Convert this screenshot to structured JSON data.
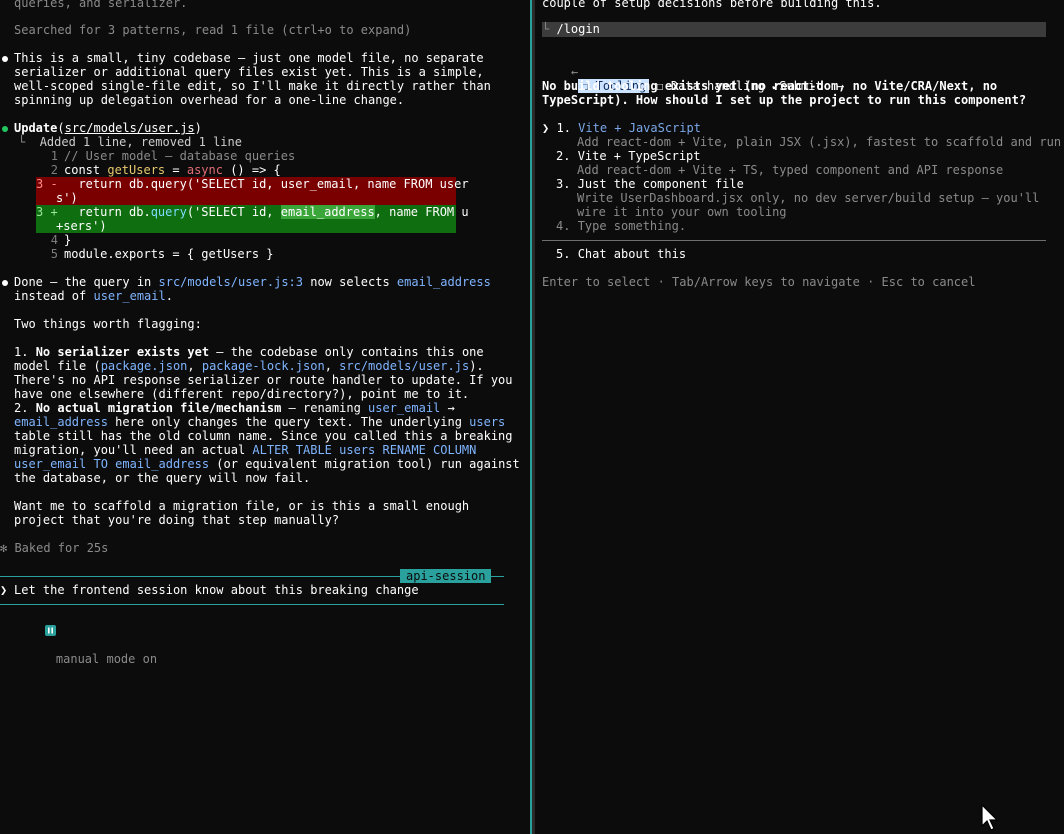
{
  "left": {
    "top_clip": "queries, and serializer.",
    "searched": "Searched for 3 patterns, read 1 file (ctrl+o to expand)",
    "para1": [
      "This is a small, tiny codebase — just one model file, no separate",
      "serializer or additional query files exist yet. This is a simple,",
      "well-scoped single-file edit, so I'll make it directly rather than",
      "spinning up delegation overhead for a one-line change."
    ],
    "update_label": "Update",
    "update_path": "src/models/user.js",
    "added_removed": "Added 1 line, removed 1 line",
    "diff": {
      "l1_num": "1",
      "l1": "// User model — database queries",
      "l2_num": "2",
      "l2_a": "const ",
      "l2_b": "getUsers",
      "l2_c": " = ",
      "l2_d": "async",
      "l2_e": " () => {",
      "l3_num": "3 -",
      "l3": "  return db.query('SELECT id, user_email, name FROM user",
      "l3_wrap": "s')",
      "l3add_num": "3 +",
      "l3add_a": "  return db.",
      "l3add_b": "query",
      "l3add_c": "('SELECT id, ",
      "l3add_d": "email_address",
      "l3add_e": ", name FROM u",
      "l3add_wrap": "+sers')",
      "l4_num": "4",
      "l4": "}",
      "l5_num": "5",
      "l5": "module.exports = { getUsers }"
    },
    "done_a": "Done — the query in ",
    "done_b": "src/models/user.js:3",
    "done_c": " now selects ",
    "done_d": "email_address",
    "done_e": "instead of ",
    "done_f": "user_email",
    "done_g": ".",
    "flag": "Two things worth flagging:",
    "item1_num": "1. ",
    "item1_bold": "No serializer exists yet",
    "item1_a": " — the codebase only contains this one",
    "item1_b1": "model file (",
    "item1_b2": "package.json",
    "item1_b3": ", ",
    "item1_b4": "package-lock.json",
    "item1_b5": ", ",
    "item1_b6": "src/models/user.js",
    "item1_b7": ").",
    "item1_c": "There's no API response serializer or route handler to update. If you",
    "item1_d": "have one elsewhere (different repo/directory?), point me to it.",
    "item2_num": "2. ",
    "item2_bold": "No actual migration file/mechanism",
    "item2_a1": " — renaming ",
    "item2_a2": "user_email",
    "item2_a3": " →",
    "item2_b1": "email_address",
    "item2_b2": " here only changes the query text. The underlying ",
    "item2_b3": "users",
    "item2_c": "table still has the old column name. Since you called this a breaking",
    "item2_d1": "migration, you'll need an actual ",
    "item2_d2": "ALTER TABLE users RENAME COLUMN",
    "item2_e1": "user_email TO email_address",
    "item2_e2": " (or equivalent migration tool) run against",
    "item2_f": "the database, or the query will now fail.",
    "want1": "Want me to scaffold a migration file, or is this a small enough",
    "want2": "project that you're doing that step manually?",
    "baked": "✻ Baked for 25s",
    "session_tag": "api-session",
    "prompt_char": "❯",
    "prompt_text": "Let the frontend session know about this breaking change",
    "mode_text": "manual mode on"
  },
  "right": {
    "top_clip": "couple of setup decisions before building this.",
    "login": "/login",
    "nav_left": "←",
    "tab1": "☐ Tooling",
    "tab2": "☐ Data handling",
    "tab3": "✔Submit",
    "nav_right": "→",
    "question1": "No build tooling exists yet (no react-dom, no Vite/CRA/Next, no",
    "question2": "TypeScript). How should I set up the project to run this component?",
    "pointer": "❯",
    "opt1_num": "1. ",
    "opt1": "Vite + JavaScript",
    "opt1_desc": "Add react-dom + Vite, plain JSX (.jsx), fastest to scaffold and run",
    "opt2_num": "2. ",
    "opt2": "Vite + TypeScript",
    "opt2_desc": "Add react-dom + Vite + TS, typed component and API response",
    "opt3_num": "3. ",
    "opt3": "Just the component file",
    "opt3_desc1": "Write UserDashboard.jsx only, no dev server/build setup — you'll",
    "opt3_desc2": "wire it into your own tooling",
    "opt4_num": "4. ",
    "opt4": "Type something.",
    "opt5_num": "5. ",
    "opt5": "Chat about this",
    "hint": "Enter to select · Tab/Arrow keys to navigate · Esc to cancel"
  },
  "colors": {
    "accent": "#2aa19c",
    "deleted": "#7a0000",
    "added": "#0f6e0f",
    "link": "#7fb4ff"
  },
  "icons": {
    "cursor": "mouse-pointer-icon",
    "mode": "pause-icon"
  }
}
